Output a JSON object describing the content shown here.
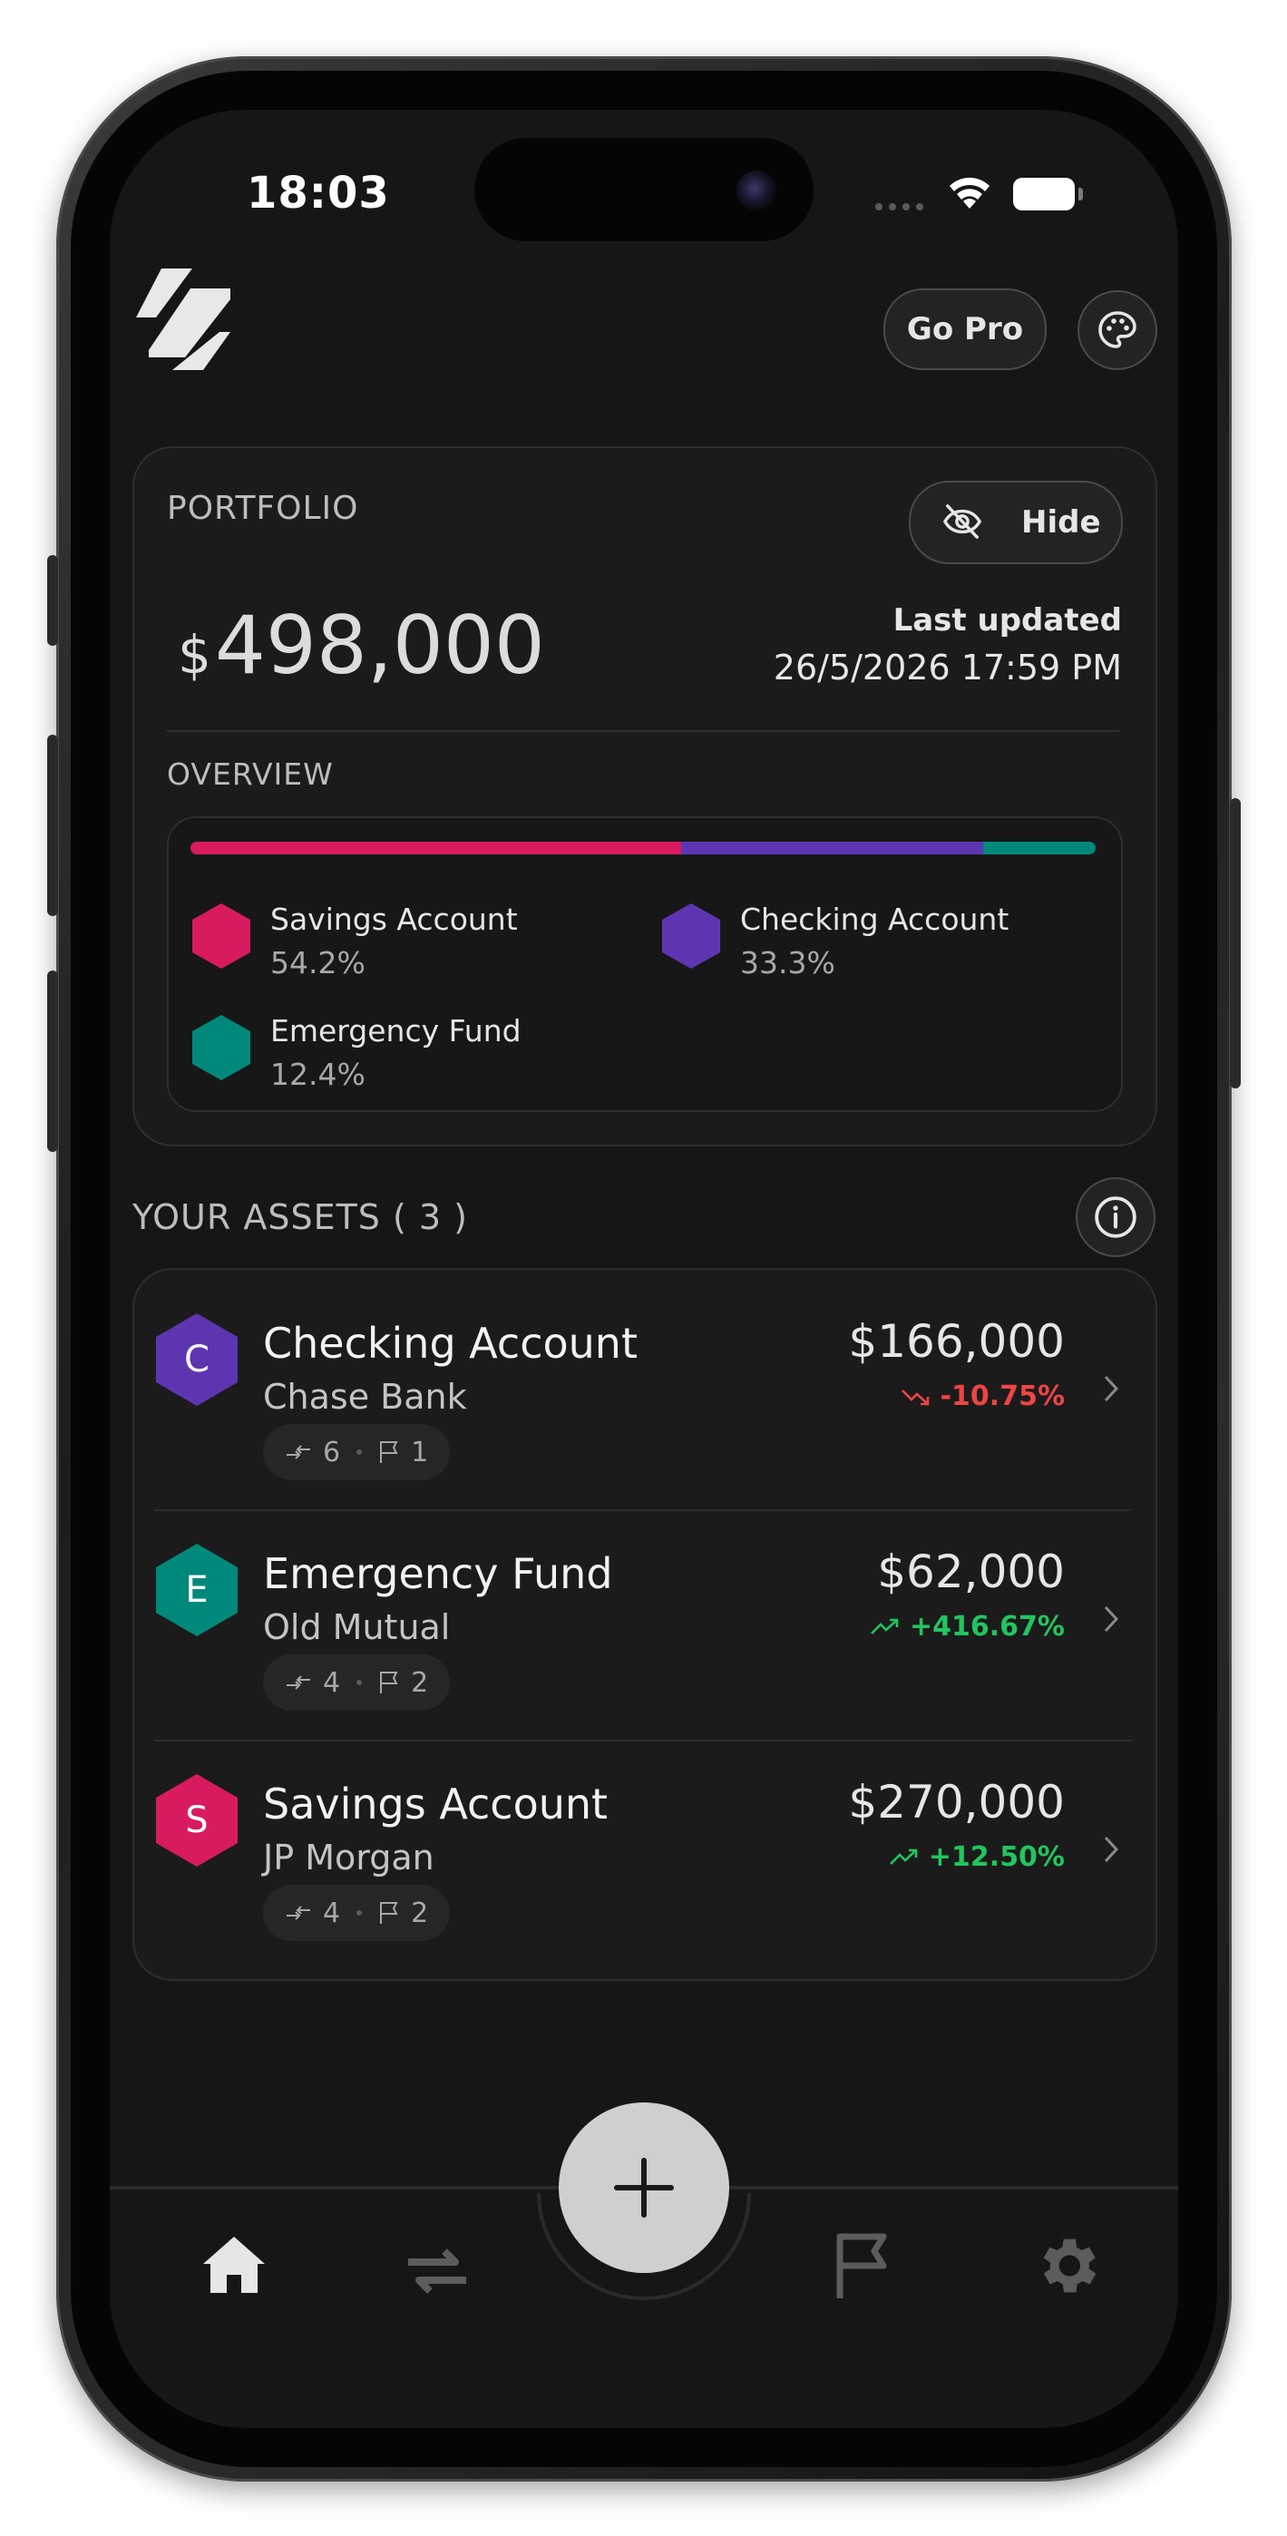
{
  "status_bar": {
    "time": "18:03"
  },
  "header": {
    "go_pro_label": "Go Pro"
  },
  "portfolio": {
    "label": "PORTFOLIO",
    "hide_label": "Hide",
    "currency_symbol": "$",
    "total": "498,000",
    "last_updated_label": "Last updated",
    "last_updated_value": "26/5/2026 17:59 PM",
    "overview_label": "OVERVIEW",
    "allocation": [
      {
        "name": "Savings Account",
        "percent_label": "54.2%",
        "percent": 54.2,
        "color": "#d81b60"
      },
      {
        "name": "Checking Account",
        "percent_label": "33.3%",
        "percent": 33.3,
        "color": "#5e35b1"
      },
      {
        "name": "Emergency Fund",
        "percent_label": "12.4%",
        "percent": 12.4,
        "color": "#00897b"
      }
    ]
  },
  "assets": {
    "title": "YOUR ASSETS ( 3 )",
    "items": [
      {
        "letter": "C",
        "name": "Checking Account",
        "bank": "Chase Bank",
        "transactions": "6",
        "goals": "1",
        "value": "$166,000",
        "change": "-10.75%",
        "trend": "down",
        "color": "#5e35b1"
      },
      {
        "letter": "E",
        "name": "Emergency Fund",
        "bank": "Old Mutual",
        "transactions": "4",
        "goals": "2",
        "value": "$62,000",
        "change": "+416.67%",
        "trend": "up",
        "color": "#00897b"
      },
      {
        "letter": "S",
        "name": "Savings Account",
        "bank": "JP Morgan",
        "transactions": "4",
        "goals": "2",
        "value": "$270,000",
        "change": "+12.50%",
        "trend": "up",
        "color": "#d81b60"
      }
    ]
  },
  "colors": {
    "up": "#22c55e",
    "down": "#ef4444",
    "accent_fab": "#cfcfcf"
  },
  "icons": {
    "nav": [
      "home-icon",
      "transfer-icon",
      "add-icon",
      "flag-icon",
      "gear-icon"
    ]
  }
}
